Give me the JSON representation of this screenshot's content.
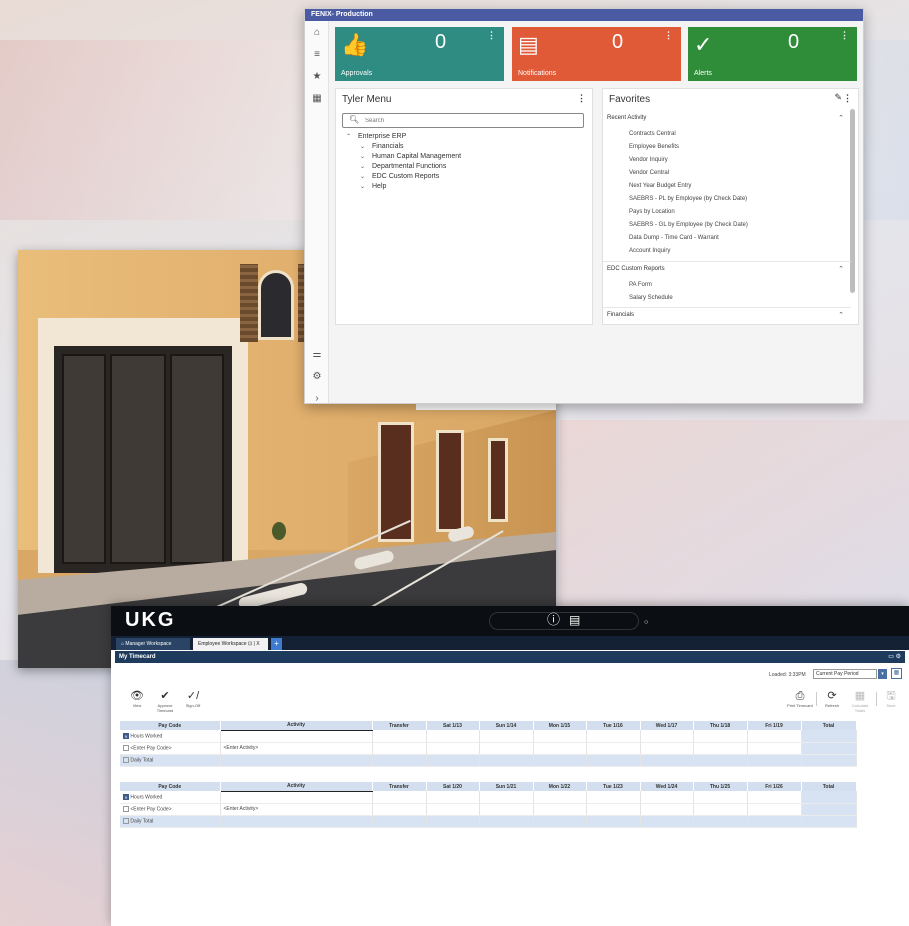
{
  "fenix": {
    "title": "FENIX- Production",
    "tiles": [
      {
        "label": "Approvals",
        "count": "0",
        "color": "#2e8c82",
        "icon": "thumbs-up-icon",
        "glyph": "👍"
      },
      {
        "label": "Notifications",
        "count": "0",
        "color": "#e05a38",
        "icon": "message-icon",
        "glyph": "▤"
      },
      {
        "label": "Alerts",
        "count": "0",
        "color": "#2f8c38",
        "icon": "check-icon",
        "glyph": "✓"
      }
    ],
    "tyler_menu": {
      "title": "Tyler Menu",
      "search_placeholder": "Search",
      "items": [
        "Enterprise ERP",
        "Financials",
        "Human Capital Management",
        "Departmental Functions",
        "EDC Custom Reports",
        "Help"
      ]
    },
    "favorites": {
      "title": "Favorites",
      "sections": [
        {
          "name": "Recent Activity",
          "items": [
            "Contracts Central",
            "Employee Benefits",
            "Vendor Inquiry",
            "Vendor Central",
            "Next Year Budget Entry",
            "SAEBRS - PL by Employee (by Check Date)",
            "Pays by Location",
            "SAEBRS - GL by Employee (by Check Date)",
            "Data Dump - Time Card - Warrant",
            "Account Inquiry"
          ]
        },
        {
          "name": "EDC Custom Reports",
          "items": [
            "PA Form",
            "Salary Schedule"
          ]
        },
        {
          "name": "Financials",
          "items": []
        }
      ]
    }
  },
  "ukg": {
    "logo": "UKG",
    "tabs": [
      "Manager Workspace",
      "Employee Workspace",
      "+"
    ],
    "tab_close": "⊡ | X",
    "page_title": "My Timecard",
    "loaded": "Loaded: 3:33PM",
    "period": "Current Pay Period",
    "left_tools": [
      {
        "label": "View",
        "glyph": "👁"
      },
      {
        "label": "Approve Timecard",
        "glyph": "✔"
      },
      {
        "label": "Sign-Off",
        "glyph": "✓/"
      }
    ],
    "right_tools": [
      {
        "label": "Print Timecard",
        "glyph": "⎙"
      },
      {
        "label": "Refresh",
        "glyph": "⟳"
      },
      {
        "label": "Calculate Totals",
        "glyph": "▦"
      },
      {
        "label": "Save",
        "glyph": "🖫"
      }
    ],
    "weeks": [
      {
        "headers": [
          "Pay Code",
          "Activity",
          "Transfer",
          "Sat 1/13",
          "Sun 1/14",
          "Mon 1/15",
          "Tue 1/16",
          "Wed 1/17",
          "Thu 1/18",
          "Fri 1/19",
          "Total"
        ],
        "rows": [
          "Hours Worked",
          "<Enter Pay Code>",
          "Daily Total"
        ],
        "activity": "<Enter Activity>"
      },
      {
        "headers": [
          "Pay Code",
          "Activity",
          "Transfer",
          "Sat 1/20",
          "Sun 1/21",
          "Mon 1/22",
          "Tue 1/23",
          "Wed 1/24",
          "Thu 1/25",
          "Fri 1/26",
          "Total"
        ],
        "rows": [
          "Hours Worked",
          "<Enter Pay Code>",
          "Daily Total"
        ],
        "activity": "<Enter Activity>"
      }
    ]
  }
}
